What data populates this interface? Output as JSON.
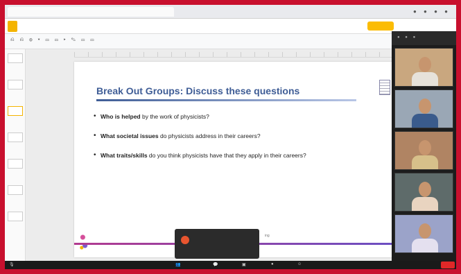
{
  "browser": {
    "tab_title": ""
  },
  "slides_app": {
    "doc_title": "",
    "present_label": "",
    "menus": []
  },
  "slide": {
    "title": "Break Out Groups:  Discuss these questions",
    "bullets": [
      {
        "bold": "Who is helped",
        "rest": " by the work of physicists?"
      },
      {
        "bold": "What societal issues",
        "rest": " do physicists address in their careers?"
      },
      {
        "bold": "What traits/skills",
        "rest": " do you think physicists have that they apply in their careers?"
      }
    ]
  },
  "notification": {
    "line1": "",
    "line2": "",
    "line3": ""
  },
  "gallery": {
    "participants": [
      {
        "shirt": "#e6e2da",
        "bg": "#c9a77f"
      },
      {
        "shirt": "#3a5b8c",
        "bg": "#9aa7b5"
      },
      {
        "shirt": "#d7c08a",
        "bg": "#b08463"
      },
      {
        "shirt": "#e9d4c0",
        "bg": "#5e6b6a"
      },
      {
        "shirt": "#e4e0ef",
        "bg": "#9ba3c9"
      }
    ]
  },
  "zoom_bar": {
    "end_label": ""
  },
  "colors": {
    "frame": "#c8102e",
    "title_blue": "#3f5d96",
    "notify_dot": "#e8552f",
    "end_red": "#e02828"
  }
}
